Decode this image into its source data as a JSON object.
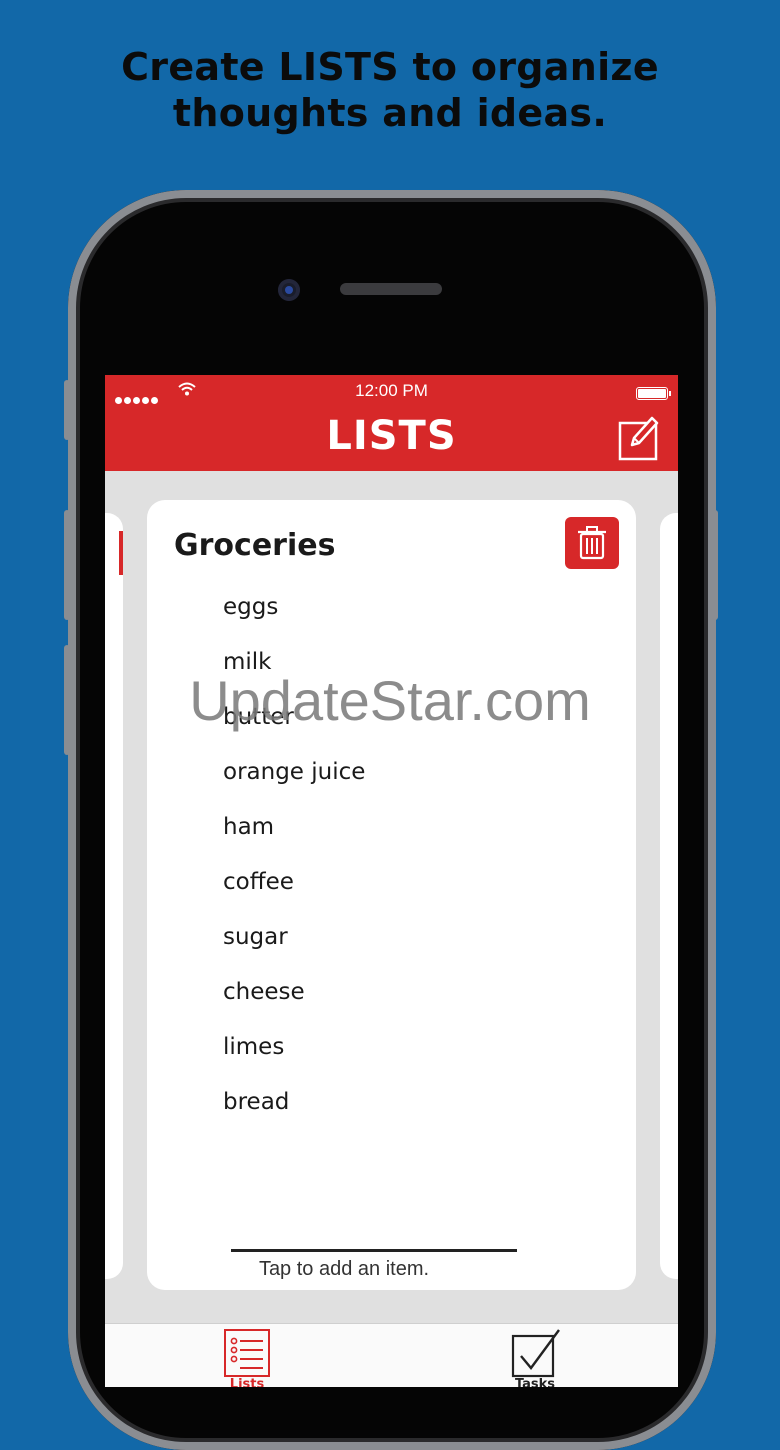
{
  "promo": {
    "headline_line1": "Create LISTS to organize",
    "headline_line2": "thoughts and ideas."
  },
  "status_bar": {
    "time": "12:00 PM"
  },
  "app_bar": {
    "title": "LISTS",
    "compose_icon": "compose-icon"
  },
  "list_card": {
    "title": "Groceries",
    "delete_icon": "trash-icon",
    "items": [
      "eggs",
      "milk",
      "butter",
      "orange juice",
      "ham",
      "coffee",
      "sugar",
      "cheese",
      "limes",
      "bread"
    ],
    "add_hint": "Tap to add an item."
  },
  "tab_bar": {
    "tabs": [
      {
        "label": "Lists",
        "icon": "list-icon",
        "active": true
      },
      {
        "label": "Tasks",
        "icon": "checkbox-icon",
        "active": false
      }
    ]
  },
  "watermark": "UpdateStar.com",
  "colors": {
    "background": "#1268a8",
    "accent": "#d72829"
  }
}
